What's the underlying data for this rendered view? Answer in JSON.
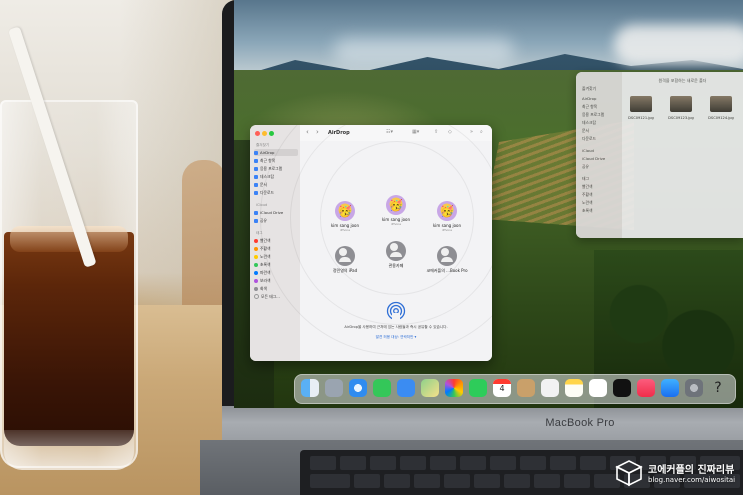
{
  "finder": {
    "toolbar_title": "AirDrop",
    "sidebar": {
      "favorites_header": "즐겨찾기",
      "favorites": [
        "AirDrop",
        "최근 항목",
        "응용 프로그램",
        "데스크탑",
        "문서",
        "다운로드"
      ],
      "icloud_header": "iCloud",
      "icloud": [
        "iCloud Drive",
        "공유"
      ],
      "tags_header": "태그",
      "tags": [
        {
          "label": "빨간색",
          "color": "#ff3b30"
        },
        {
          "label": "주황색",
          "color": "#ff9500"
        },
        {
          "label": "노란색",
          "color": "#ffcc00"
        },
        {
          "label": "초록색",
          "color": "#34c759"
        },
        {
          "label": "파란색",
          "color": "#007aff"
        },
        {
          "label": "보라색",
          "color": "#af52de"
        },
        {
          "label": "회색",
          "color": "#8e8e93"
        },
        {
          "label": "모든 태그...",
          "color": ""
        }
      ]
    },
    "devices": [
      {
        "name": "kim sang joon",
        "sub": "iPhone",
        "avatar": "🥳"
      },
      {
        "name": "kim sang joon",
        "sub": "iPhone",
        "avatar": "🥳"
      },
      {
        "name": "kim sang joon",
        "sub": "iPhone",
        "avatar": "🥳"
      },
      {
        "name": "정민영의 iPad",
        "sub": "",
        "avatar": "person"
      },
      {
        "name": "관용카페",
        "sub": "",
        "avatar": "person"
      },
      {
        "name": "코에커플의 ...Book Pro",
        "sub": "",
        "avatar": "person"
      }
    ],
    "airdrop_description": "AirDrop을 사용하여 근처에 있는 사람들과 즉시 공유할 수 있습니다.",
    "airdrop_link": "발견 허용 대상: 연락처만 ▾"
  },
  "finder2": {
    "title": "원격을 포함하는 새로운 폴더",
    "sidebar": [
      "즐겨찾기",
      "AirDrop",
      "최근 항목",
      "응용 프로그램",
      "데스크탑",
      "문서",
      "다운로드",
      "iCloud",
      "iCloud Drive",
      "공유",
      "태그",
      "빨간색",
      "주황색",
      "노란색",
      "초록색"
    ],
    "files": [
      "DSC09121.jpg",
      "DSC09123.jpg",
      "DSC09124.jpg"
    ]
  },
  "dock": {
    "calendar_day": "4",
    "icons": [
      "finder-icon",
      "launchpad-icon",
      "safari-icon",
      "messages-icon",
      "mail-icon",
      "maps-icon",
      "photos-icon",
      "facetime-icon",
      "calendar-icon",
      "contacts-icon",
      "reminders-icon",
      "notes-icon",
      "freeform-icon",
      "appletv-icon",
      "music-icon",
      "appstore-icon",
      "system-settings-icon",
      "help-icon"
    ]
  },
  "laptop": {
    "label": "MacBook Pro"
  },
  "watermark": {
    "title": "코에커플의 진짜리뷰",
    "url": "blog.naver.com/aiwositai"
  }
}
